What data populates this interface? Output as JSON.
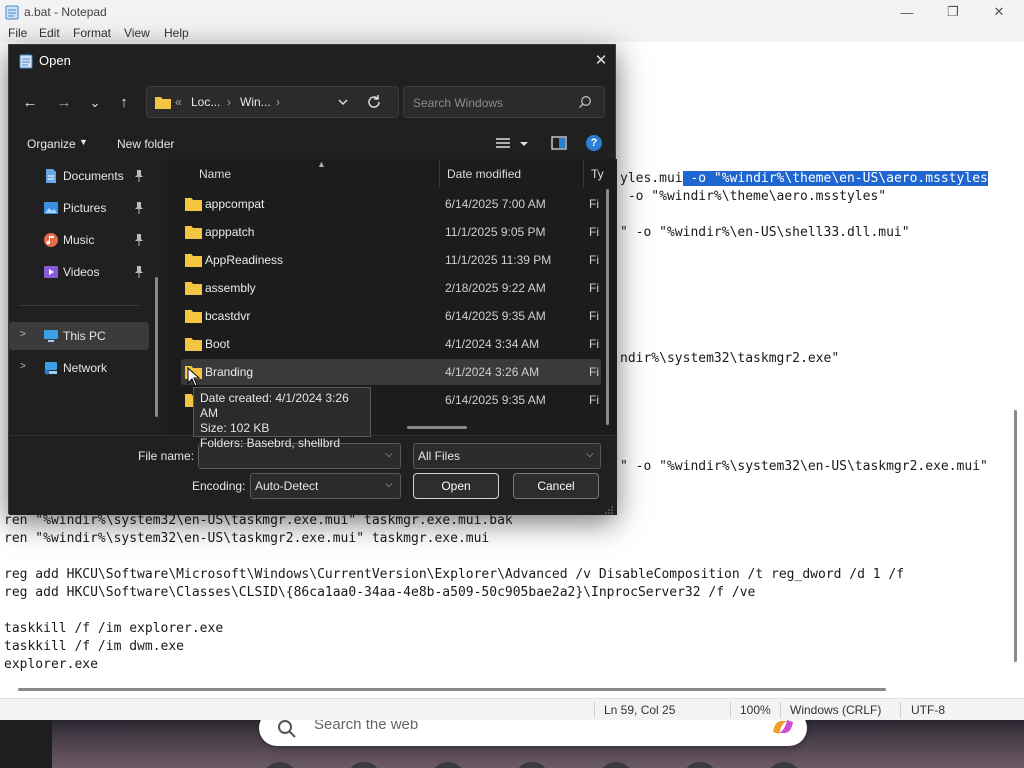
{
  "notepad": {
    "title": "a.bat - Notepad",
    "menu": [
      "File",
      "Edit",
      "Format",
      "View",
      "Help"
    ],
    "window_controls": {
      "minimize": "—",
      "maximize": "❐",
      "close": "✕"
    },
    "partial_lines": [
      {
        "text": "yles.mui",
        "highlight": " -o \"%windir%\\theme\\en-US\\aero.msstyles"
      },
      {
        "text": " -o \"%windir%\\theme\\aero.msstyles\""
      },
      {
        "text": "\" -o \"%windir%\\en-US\\shell33.dll.mui\""
      },
      {
        "text": "ndir%\\system32\\taskmgr2.exe\""
      },
      {
        "text": "\" -o \"%windir%\\system32\\en-US\\taskmgr2.exe.mui\""
      }
    ],
    "lines": [
      "ren \"%windir%\\system32\\en-US\\taskmgr.exe.mui\" taskmgr.exe.mui.bak",
      "ren \"%windir%\\system32\\en-US\\taskmgr2.exe.mui\" taskmgr.exe.mui",
      "reg add HKCU\\Software\\Microsoft\\Windows\\CurrentVersion\\Explorer\\Advanced /v DisableComposition /t reg_dword /d 1 /f",
      "reg add HKCU\\Software\\Classes\\CLSID\\{86ca1aa0-34aa-4e8b-a509-50c905bae2a2}\\InprocServer32 /f /ve",
      "taskkill /f /im explorer.exe",
      "taskkill /f /im dwm.exe",
      "explorer.exe"
    ],
    "status": {
      "position": "Ln 59, Col 25",
      "zoom": "100%",
      "line_ending": "Windows (CRLF)",
      "encoding": "UTF-8"
    }
  },
  "dialog": {
    "title": "Open",
    "close": "✕",
    "nav": {
      "back": "←",
      "forward": "→",
      "recent": "⌄",
      "up": "↑"
    },
    "address": {
      "sep0": "«",
      "crumb1": "Loc...",
      "sep1": "›",
      "crumb2": "Win...",
      "sep2": "›"
    },
    "search_placeholder": "Search Windows",
    "organize_label": "Organize",
    "new_folder_label": "New folder",
    "help": "?",
    "nav_items": [
      {
        "label": "Documents"
      },
      {
        "label": "Pictures"
      },
      {
        "label": "Music"
      },
      {
        "label": "Videos"
      },
      {
        "label": "This PC"
      },
      {
        "label": "Network"
      }
    ],
    "columns": {
      "name": "Name",
      "date": "Date modified",
      "type": "Ty"
    },
    "files": [
      {
        "name": "appcompat",
        "date": "6/14/2025 7:00 AM",
        "type": "Fi"
      },
      {
        "name": "apppatch",
        "date": "11/1/2025 9:05 PM",
        "type": "Fi"
      },
      {
        "name": "AppReadiness",
        "date": "11/1/2025 11:39 PM",
        "type": "Fi"
      },
      {
        "name": "assembly",
        "date": "2/18/2025 9:22 AM",
        "type": "Fi"
      },
      {
        "name": "bcastdvr",
        "date": "6/14/2025 9:35 AM",
        "type": "Fi"
      },
      {
        "name": "Boot",
        "date": "4/1/2024 3:34 AM",
        "type": "Fi"
      },
      {
        "name": "Branding",
        "date": "4/1/2024 3:26 AM",
        "type": "Fi"
      },
      {
        "name": "",
        "date": "6/14/2025 9:35 AM",
        "type": "Fi"
      }
    ],
    "tooltip": [
      "Date created: 4/1/2024 3:26 AM",
      "Size: 102 KB",
      "Folders: Basebrd, shellbrd"
    ],
    "file_name_label": "File name:",
    "file_name_value": "",
    "filter_value": "All Files",
    "encoding_label": "Encoding:",
    "encoding_value": "Auto-Detect",
    "open_label": "Open",
    "cancel_label": "Cancel"
  },
  "web_search": {
    "placeholder": "Search the web"
  },
  "colors": {
    "accent": "#1f66d1",
    "dialog_bg": "#202020",
    "folder": "#f5c542"
  }
}
